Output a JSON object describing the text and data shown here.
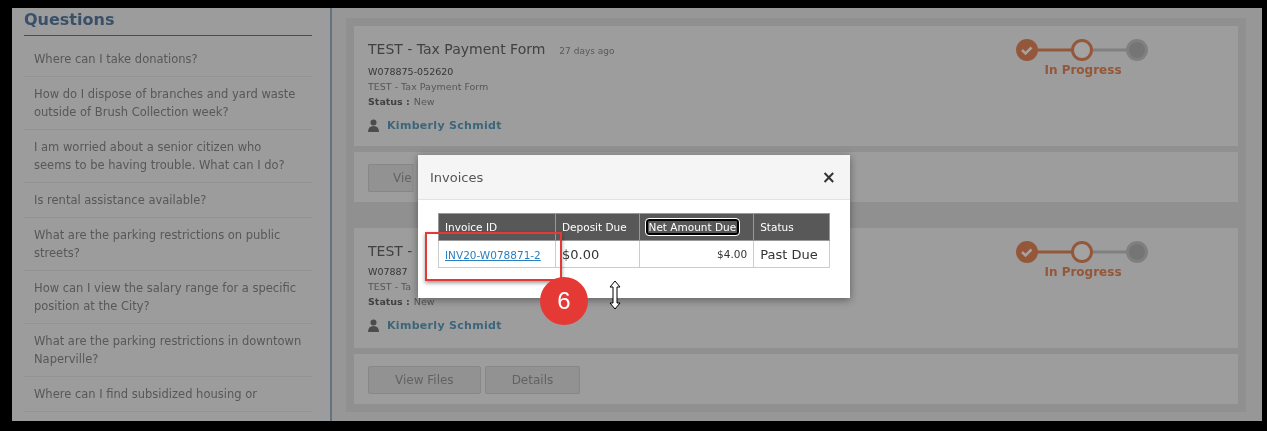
{
  "sidebar": {
    "title": "Questions",
    "items": [
      "Where can I take donations?",
      "How do I dispose of branches and yard waste outside of Brush Collection week?",
      "I am worried about a senior citizen who seems to be having trouble. What can I do?",
      "Is rental assistance available?",
      "What are the parking restrictions on public streets?",
      "How can I view the salary range for a specific position at the City?",
      "What are the parking restrictions in downtown Naperville?",
      "Where can I find subsidized housing or"
    ]
  },
  "requests": [
    {
      "title": "TEST - Tax Payment Form",
      "age": "27 days ago",
      "number": "W078875-052620",
      "description": "TEST - Tax Payment Form",
      "status_label": "Status :",
      "status": "New",
      "person": "Kimberly Schmidt",
      "steps": [
        {
          "kind": "done"
        },
        {
          "kind": "current"
        },
        {
          "kind": "pending"
        }
      ],
      "step_label": "In Progress",
      "buttons": [
        "Vie"
      ]
    },
    {
      "title": "TEST -",
      "number": "W07887",
      "description": "TEST - Ta",
      "status_label": "Status :",
      "status": "New",
      "person": "Kimberly Schmidt",
      "steps": [
        {
          "kind": "done"
        },
        {
          "kind": "current"
        },
        {
          "kind": "pending"
        }
      ],
      "step_label": "In Progress",
      "buttons": [
        "View Files",
        "Details"
      ]
    }
  ],
  "modal": {
    "title": "Invoices",
    "close": "×",
    "columns": [
      {
        "label": "Invoice ID",
        "focused": false
      },
      {
        "label": "Deposit Due",
        "focused": false
      },
      {
        "label": "Net Amount Due",
        "focused": true
      },
      {
        "label": "Status",
        "focused": false
      }
    ],
    "rows": [
      {
        "cells": [
          {
            "kind": "link",
            "text": "INV20-W078871-2"
          },
          {
            "kind": "text",
            "text": "$0.00"
          },
          {
            "kind": "amount",
            "text": "$4.00"
          },
          {
            "kind": "text",
            "text": "Past Due"
          }
        ]
      }
    ]
  },
  "callout": {
    "number": "6"
  }
}
